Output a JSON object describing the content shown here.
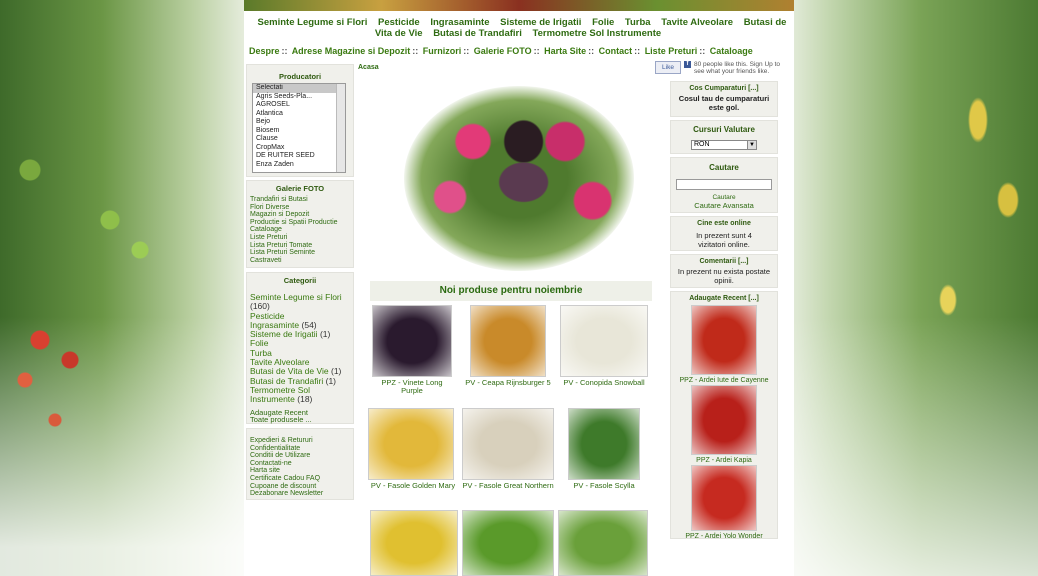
{
  "nav_top": [
    "Seminte Legume si Flori",
    "Pesticide",
    "Ingrasaminte",
    "Sisteme de Irigatii",
    "Folie",
    "Turba",
    "Tavite Alveolare",
    "Butasi de Vita de Vie",
    "Butasi de Trandafiri",
    "Termometre Sol Instrumente"
  ],
  "nav_links": [
    "Despre",
    "Adrese Magazine si Depozit",
    "Furnizori",
    "Galerie FOTO",
    "Harta Site",
    "Contact",
    "Liste Preturi",
    "Cataloage"
  ],
  "nav_sep": "::",
  "breadcrumb": "Acasa",
  "facebook": {
    "like": "Like",
    "text": "80 people like this. Sign Up to see what your friends like."
  },
  "producatori": {
    "title": "Producatori",
    "options": [
      "Selectati",
      "Agris Seeds-Pla...",
      "AGROSEL",
      "Atlantica",
      "Bejo",
      "Biosem",
      "Clause",
      "CropMax",
      "DE RUITER SEED",
      "Enza Zaden"
    ]
  },
  "galerie": {
    "title": "Galerie FOTO",
    "links": [
      "Trandafiri si Butasi",
      "Flori Diverse",
      "Magazin si Depozit",
      "Productie si Spatii Productie",
      "Cataloage",
      "Liste Preturi",
      "Lista Preturi Tomate",
      "Lista Preturi Seminte",
      "Castraveti"
    ]
  },
  "categorii": {
    "title": "Categorii",
    "items": [
      {
        "name": "Seminte Legume si Flori",
        "count": "(160)"
      },
      {
        "name": "Pesticide",
        "count": ""
      },
      {
        "name": "Ingrasaminte",
        "count": "(54)"
      },
      {
        "name": "Sisteme de Irigatii",
        "count": "(1)"
      },
      {
        "name": "Folie",
        "count": ""
      },
      {
        "name": "Turba",
        "count": ""
      },
      {
        "name": "Tavite Alveolare",
        "count": ""
      },
      {
        "name": "Butasi de Vita de Vie",
        "count": "(1)"
      },
      {
        "name": "Butasi de Trandafiri",
        "count": "(1)"
      },
      {
        "name": "Termometre Sol Instrumente",
        "count": "(18)"
      }
    ],
    "recent": "Adaugate Recent",
    "all": "Toate produsele ..."
  },
  "info": [
    "Expedieri & Retururi",
    "Confidentialitate",
    "Conditii de Utilizare",
    "Contactati-ne",
    "Harta site",
    "Certificate Cadou FAQ",
    "Cupoane de discount",
    "Dezabonare Newsletter"
  ],
  "new_products_title": "Noi produse pentru noiembrie",
  "products": [
    {
      "name": "PPZ - Vinete Long Purple",
      "color": "#2a1a2e"
    },
    {
      "name": "PV - Ceapa Rijnsburger 5",
      "color": "#c98a2a"
    },
    {
      "name": "PV - Conopida Snowball",
      "color": "#e8e6d8"
    },
    {
      "name": "PV - Fasole Golden Mary",
      "color": "#e2b83a"
    },
    {
      "name": "PV - Fasole Great Northern",
      "color": "#d8d0bc"
    },
    {
      "name": "PV - Fasole Scylla",
      "color": "#3e7a2a"
    },
    {
      "name": "",
      "color": "#e0c030"
    },
    {
      "name": "",
      "color": "#5a9a2a"
    },
    {
      "name": "",
      "color": "#6aa03a"
    }
  ],
  "cos": {
    "title": "Cos Cumparaturi [...]",
    "text": "Cosul tau de cumparaturi este gol."
  },
  "curs": {
    "title": "Cursuri Valutare",
    "value": "RON"
  },
  "cautare": {
    "title": "Cautare",
    "label": "Cautare",
    "advanced": "Cautare Avansata"
  },
  "online": {
    "title": "Cine este online",
    "text": "In prezent sunt 4 vizitatori online."
  },
  "comentarii": {
    "title": "Comentarii [...]",
    "text": "In prezent nu exista postate opinii."
  },
  "adaugate": {
    "title": "Adaugate Recent [...]",
    "items": [
      {
        "name": "PPZ - Ardei Iute de Cayenne",
        "color": "#c02a1a"
      },
      {
        "name": "PPZ - Ardei Kapia",
        "color": "#b8201a"
      },
      {
        "name": "PPZ - Ardei Yolo Wonder",
        "color": "#c62a20"
      }
    ]
  }
}
